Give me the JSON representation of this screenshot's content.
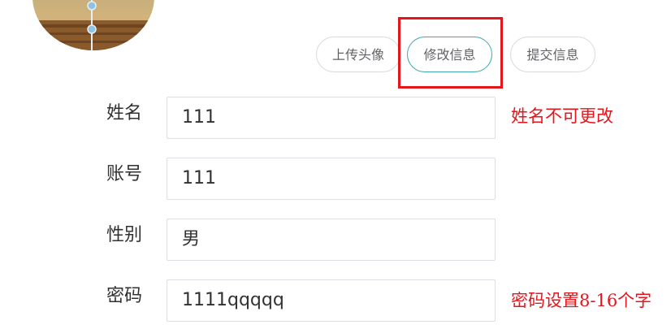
{
  "toolbar": {
    "upload_label": "上传头像",
    "edit_label": "修改信息",
    "submit_label": "提交信息"
  },
  "form": {
    "name": {
      "label": "姓名",
      "value": "111"
    },
    "account": {
      "label": "账号",
      "value": "111"
    },
    "gender": {
      "label": "性别",
      "value": "男"
    },
    "password": {
      "label": "密码",
      "value": "1111qqqqq"
    }
  },
  "annotations": {
    "name_note": "姓名不可更改",
    "password_note": "密码设置8-16个字",
    "highlight_color": "#e4161b"
  },
  "colors": {
    "accent": "#3ba7b3",
    "annotation": "#e4161b"
  }
}
